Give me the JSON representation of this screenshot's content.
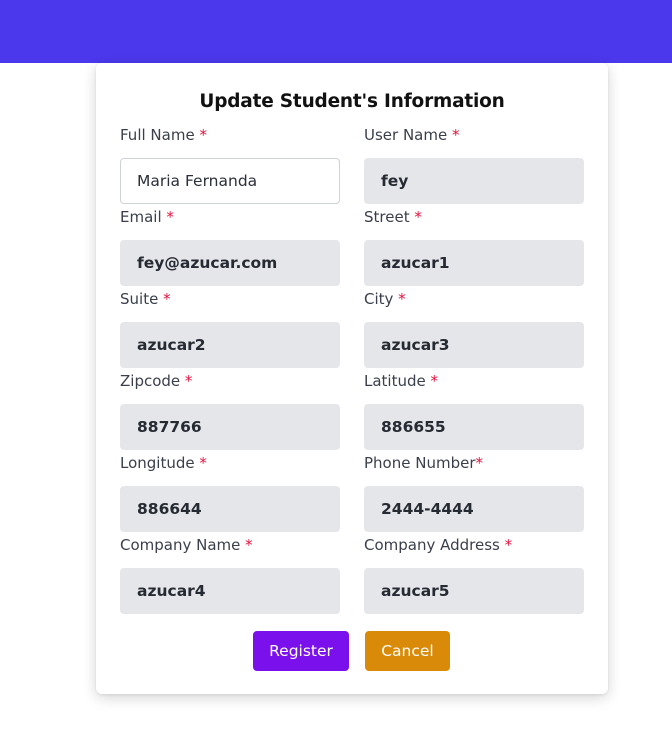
{
  "colors": {
    "header_bar": "#4b38ec",
    "required_mark": "#e3123e",
    "register_button": "#7a10ec",
    "cancel_button": "#d88a08"
  },
  "form": {
    "title": "Update Student's Information",
    "required_marker": "*",
    "fields": {
      "full_name": {
        "label": "Full Name ",
        "value": "Maria Fernanda"
      },
      "user_name": {
        "label": "User Name ",
        "value": "fey"
      },
      "email": {
        "label": "Email ",
        "value": "fey@azucar.com"
      },
      "street": {
        "label": "Street ",
        "value": "azucar1"
      },
      "suite": {
        "label": "Suite ",
        "value": "azucar2"
      },
      "city": {
        "label": "City ",
        "value": "azucar3"
      },
      "zipcode": {
        "label": "Zipcode ",
        "value": "887766"
      },
      "latitude": {
        "label": "Latitude ",
        "value": "886655"
      },
      "longitude": {
        "label": "Longitude ",
        "value": "886644"
      },
      "phone_number": {
        "label": "Phone Number",
        "value": "2444-4444"
      },
      "company_name": {
        "label": "Company Name ",
        "value": "azucar4"
      },
      "company_address": {
        "label": "Company Address ",
        "value": "azucar5"
      }
    },
    "buttons": {
      "register_label": "Register",
      "cancel_label": "Cancel"
    }
  }
}
